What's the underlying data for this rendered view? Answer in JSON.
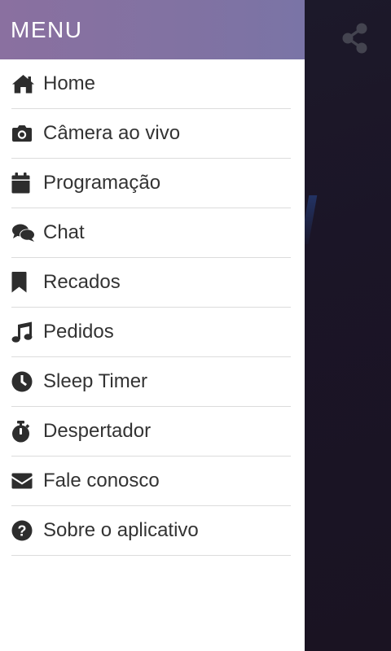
{
  "drawer": {
    "title": "MENU",
    "items": [
      {
        "label": "Home",
        "icon": "home-icon"
      },
      {
        "label": "Câmera ao vivo",
        "icon": "camera-icon"
      },
      {
        "label": "Programação",
        "icon": "calendar-icon"
      },
      {
        "label": "Chat",
        "icon": "chat-icon"
      },
      {
        "label": "Recados",
        "icon": "bookmark-icon"
      },
      {
        "label": "Pedidos",
        "icon": "music-icon"
      },
      {
        "label": "Sleep Timer",
        "icon": "clock-icon"
      },
      {
        "label": "Despertador",
        "icon": "stopwatch-icon"
      },
      {
        "label": "Fale conosco",
        "icon": "envelope-icon"
      },
      {
        "label": "Sobre o aplicativo",
        "icon": "question-circle-icon"
      }
    ]
  },
  "topbar": {
    "share_icon": "share-icon"
  },
  "colors": {
    "header_start": "#8a70a0",
    "header_end": "#7a74a6",
    "icon": "#2d2d2d",
    "text": "#333333",
    "divider": "#dcdcdc",
    "background": "#1b1627"
  }
}
